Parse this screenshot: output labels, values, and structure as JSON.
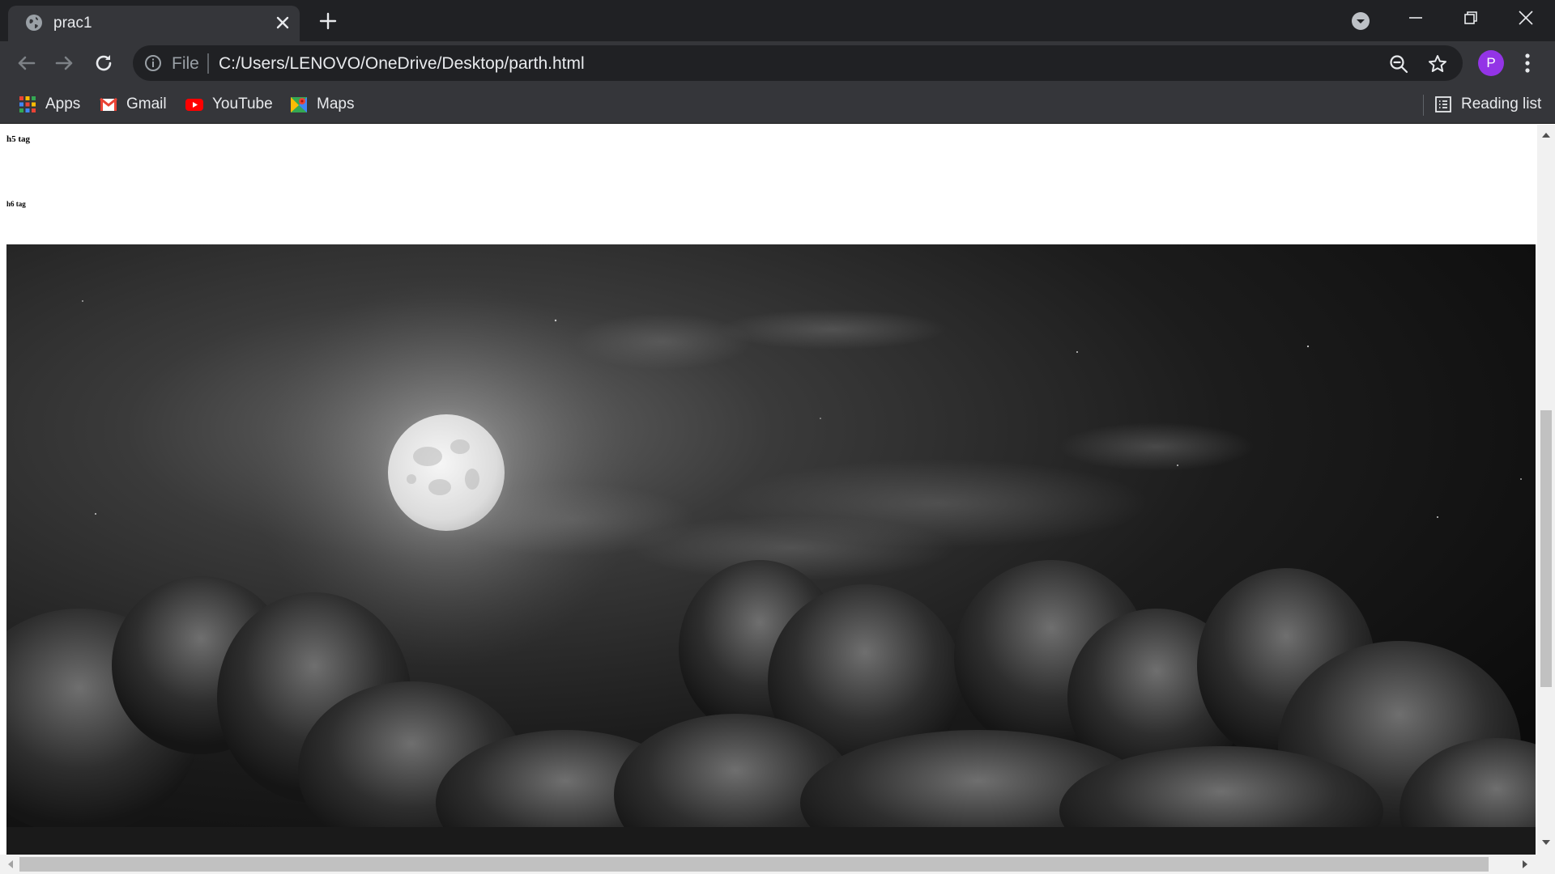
{
  "browser": {
    "tab": {
      "title": "prac1"
    },
    "address_bar": {
      "scheme_label": "File",
      "url": "C:/Users/LENOVO/OneDrive/Desktop/parth.html"
    },
    "profile": {
      "initial": "P",
      "color": "#9334e6"
    },
    "bookmarks": [
      {
        "label": "Apps",
        "icon": "apps-grid-icon"
      },
      {
        "label": "Gmail",
        "icon": "gmail-icon"
      },
      {
        "label": "YouTube",
        "icon": "youtube-icon"
      },
      {
        "label": "Maps",
        "icon": "maps-icon"
      }
    ],
    "reading_list": {
      "label": "Reading list",
      "icon": "reading-list-icon"
    }
  },
  "page": {
    "h5_text": "h5 tag",
    "h6_text": "h6 tag",
    "image": {
      "subject": "full moon above dark clouds, black and white"
    }
  },
  "colors": {
    "frame_dark": "#202124",
    "frame_toolbar": "#35363a",
    "text_light": "#e8eaed",
    "avatar_purple": "#9334e6"
  }
}
